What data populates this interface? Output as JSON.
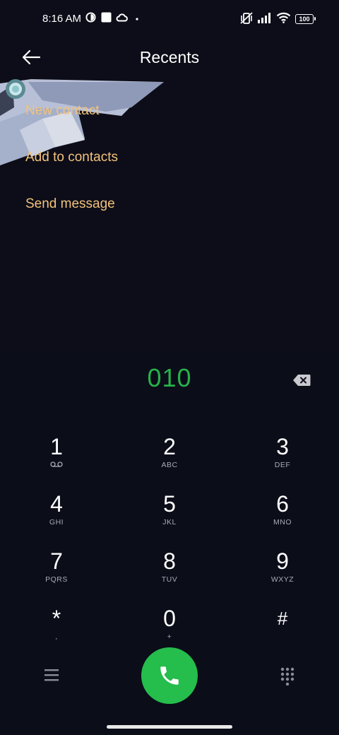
{
  "status_bar": {
    "time": "8:16 AM",
    "battery": "100"
  },
  "header": {
    "title": "Recents"
  },
  "actions": {
    "new_contact": "New contact",
    "add_to_contacts": "Add to contacts",
    "send_message": "Send message"
  },
  "dialer": {
    "number": "010",
    "number_color": "#27b24a",
    "keys": [
      {
        "digit": "1",
        "letters": ""
      },
      {
        "digit": "2",
        "letters": "ABC"
      },
      {
        "digit": "3",
        "letters": "DEF"
      },
      {
        "digit": "4",
        "letters": "GHI"
      },
      {
        "digit": "5",
        "letters": "JKL"
      },
      {
        "digit": "6",
        "letters": "MNO"
      },
      {
        "digit": "7",
        "letters": "PQRS"
      },
      {
        "digit": "8",
        "letters": "TUV"
      },
      {
        "digit": "9",
        "letters": "WXYZ"
      },
      {
        "digit": "*",
        "letters": ","
      },
      {
        "digit": "0",
        "letters": "+"
      },
      {
        "digit": "#",
        "letters": ""
      }
    ]
  },
  "colors": {
    "background": "#0c0d18",
    "accent_action": "#f3c27b",
    "call_button": "#25bd4c"
  },
  "icons": {
    "voicemail": "voicemail-icon",
    "backspace": "backspace-icon",
    "call": "phone-icon",
    "menu": "menu-icon",
    "dialpad": "dialpad-icon"
  }
}
